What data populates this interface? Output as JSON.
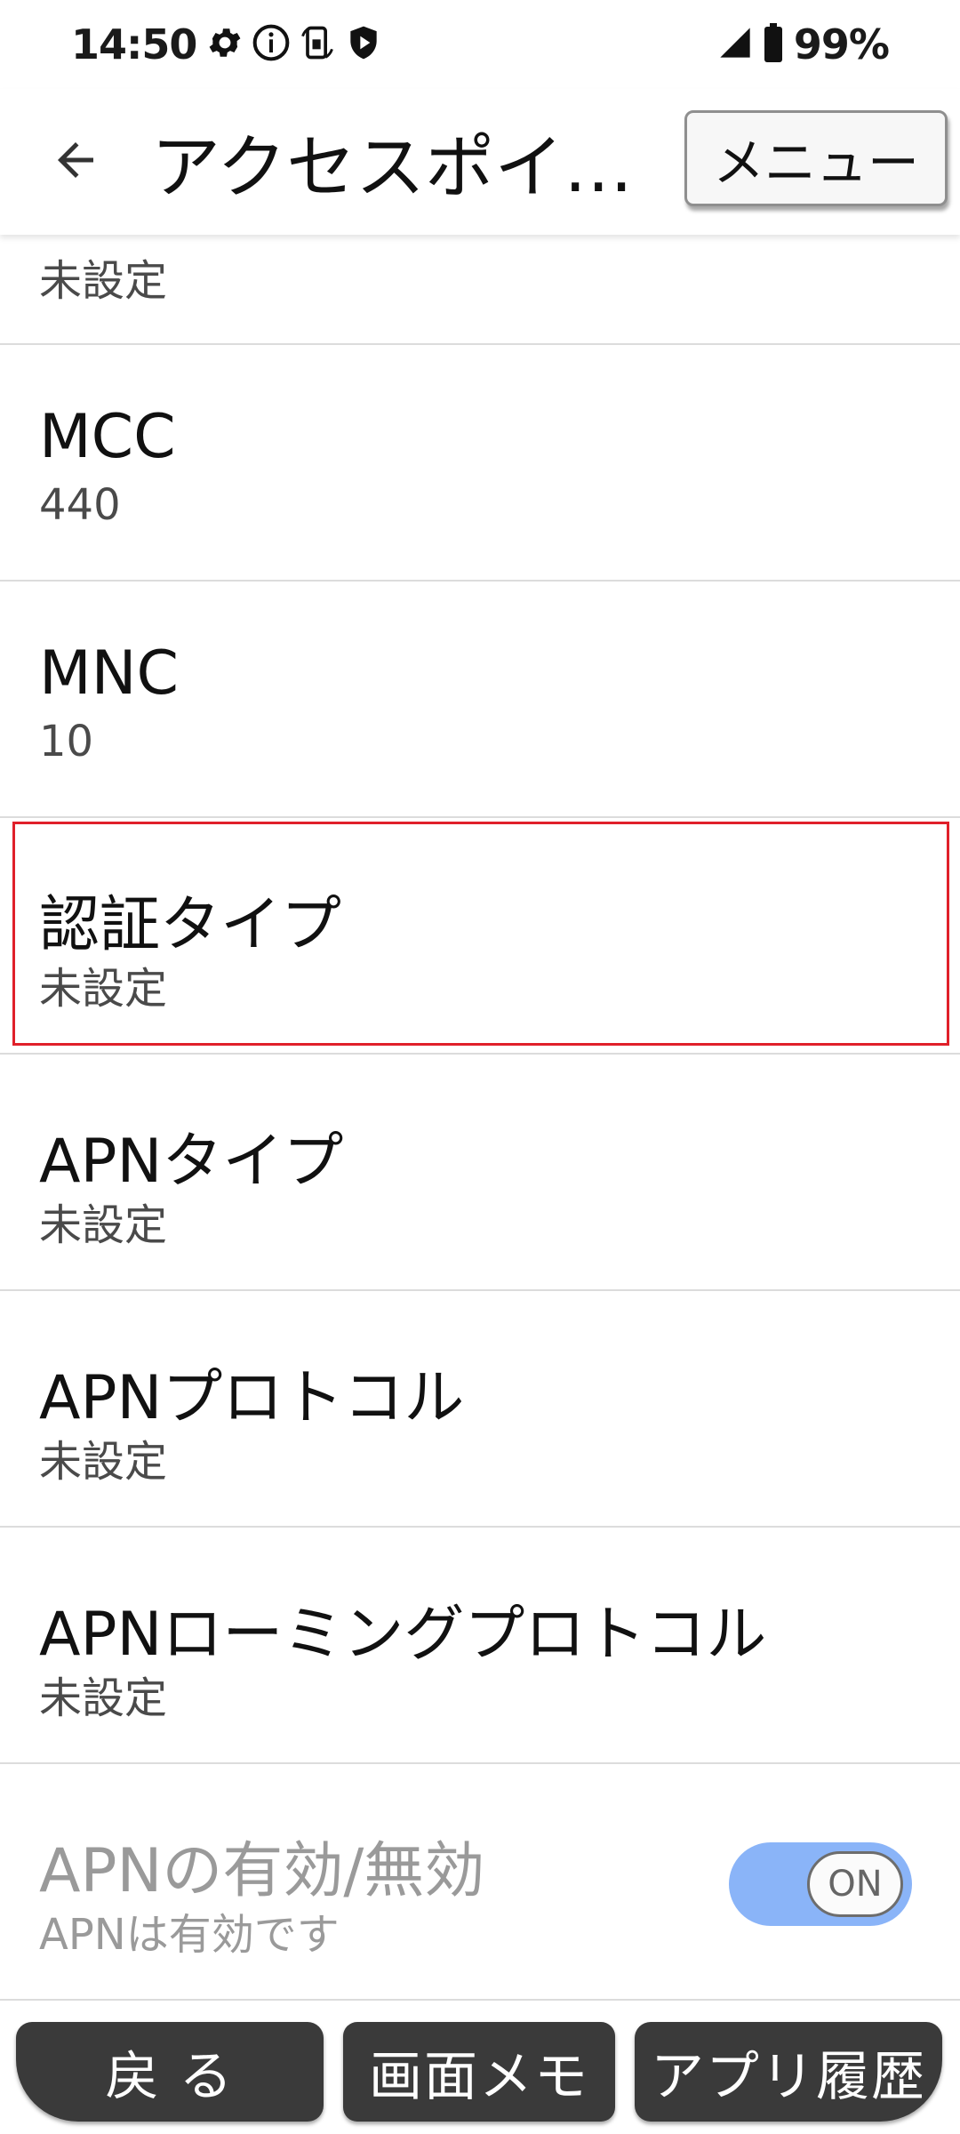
{
  "status_bar": {
    "time": "14:50",
    "battery": "99%",
    "icons": [
      "gear-icon",
      "info-icon",
      "screen-rotate-icon",
      "shield-icon",
      "signal-icon",
      "battery-icon"
    ]
  },
  "app_bar": {
    "title": "アクセスポイ…",
    "menu_label": "メニュー"
  },
  "list": {
    "partial_sub": "未設定",
    "items": [
      {
        "title": "MCC",
        "sub": "440"
      },
      {
        "title": "MNC",
        "sub": "10"
      },
      {
        "title": "認証タイプ",
        "sub": "未設定"
      },
      {
        "title": "APNタイプ",
        "sub": "未設定"
      },
      {
        "title": "APNプロトコル",
        "sub": "未設定"
      },
      {
        "title": "APNローミングプロトコル",
        "sub": "未設定"
      },
      {
        "title": "APNの有効/無効",
        "sub": "APNは有効です"
      }
    ],
    "toggle_label": "ON"
  },
  "bottom_nav": {
    "back": "戻 る",
    "memo": "画面メモ",
    "history": "アプリ履歴"
  },
  "colors": {
    "highlight": "#e0202a",
    "toggle_track": "#8ab4f8",
    "nav_button": "#3a3a3a"
  }
}
